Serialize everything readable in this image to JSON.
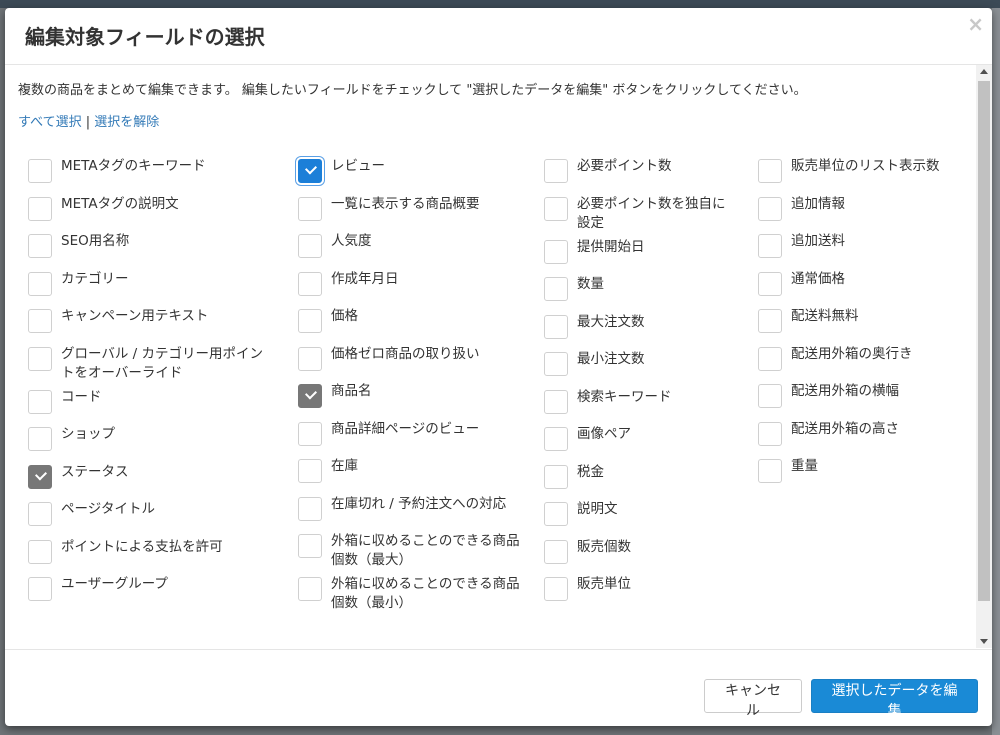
{
  "modal": {
    "title": "編集対象フィールドの選択",
    "close": "×",
    "description": "複数の商品をまとめて編集できます。 編集したいフィールドをチェックして \"選択したデータを編集\" ボタンをクリックしてください。",
    "select_all": "すべて選択",
    "separator": "|",
    "deselect": "選択を解除"
  },
  "fields": {
    "col1": [
      {
        "label": "METAタグのキーワード",
        "checked": false
      },
      {
        "label": "METAタグの説明文",
        "checked": false
      },
      {
        "label": "SEO用名称",
        "checked": false
      },
      {
        "label": "カテゴリー",
        "checked": false
      },
      {
        "label": "キャンペーン用テキスト",
        "checked": false
      },
      {
        "label": "グローバル / カテゴリー用ポイントをオーバーライド",
        "checked": false
      },
      {
        "label": "コード",
        "checked": false
      },
      {
        "label": "ショップ",
        "checked": false
      },
      {
        "label": "ステータス",
        "checked": true
      },
      {
        "label": "ページタイトル",
        "checked": false
      },
      {
        "label": "ポイントによる支払を許可",
        "checked": false
      },
      {
        "label": "ユーザーグループ",
        "checked": false
      }
    ],
    "col2": [
      {
        "label": "レビュー",
        "checked": true
      },
      {
        "label": "一覧に表示する商品概要",
        "checked": false
      },
      {
        "label": "人気度",
        "checked": false
      },
      {
        "label": "作成年月日",
        "checked": false
      },
      {
        "label": "価格",
        "checked": false
      },
      {
        "label": "価格ゼロ商品の取り扱い",
        "checked": false
      },
      {
        "label": "商品名",
        "checked": true
      },
      {
        "label": "商品詳細ページのビュー",
        "checked": false
      },
      {
        "label": "在庫",
        "checked": false
      },
      {
        "label": "在庫切れ / 予約注文への対応",
        "checked": false
      },
      {
        "label": "外箱に収めることのできる商品個数（最大）",
        "checked": false
      },
      {
        "label": "外箱に収めることのできる商品個数（最小）",
        "checked": false
      }
    ],
    "col3": [
      {
        "label": "必要ポイント数",
        "checked": false
      },
      {
        "label": "必要ポイント数を独自に設定",
        "checked": false
      },
      {
        "label": "提供開始日",
        "checked": false
      },
      {
        "label": "数量",
        "checked": false
      },
      {
        "label": "最大注文数",
        "checked": false
      },
      {
        "label": "最小注文数",
        "checked": false
      },
      {
        "label": "検索キーワード",
        "checked": false
      },
      {
        "label": "画像ペア",
        "checked": false
      },
      {
        "label": "税金",
        "checked": false
      },
      {
        "label": "説明文",
        "checked": false
      },
      {
        "label": "販売個数",
        "checked": false
      },
      {
        "label": "販売単位",
        "checked": false
      }
    ],
    "col4": [
      {
        "label": "販売単位のリスト表示数",
        "checked": false
      },
      {
        "label": "追加情報",
        "checked": false
      },
      {
        "label": "追加送料",
        "checked": false
      },
      {
        "label": "通常価格",
        "checked": false
      },
      {
        "label": "配送料無料",
        "checked": false
      },
      {
        "label": "配送用外箱の奥行き",
        "checked": false
      },
      {
        "label": "配送用外箱の横幅",
        "checked": false
      },
      {
        "label": "配送用外箱の高さ",
        "checked": false
      },
      {
        "label": "重量",
        "checked": false
      }
    ]
  },
  "footer": {
    "cancel_label": "キャンセル",
    "submit_label": "選択したデータを編集"
  },
  "colors": {
    "primary": "#1a8ad6",
    "checked_gray": "#777777",
    "link": "#337ab7"
  }
}
